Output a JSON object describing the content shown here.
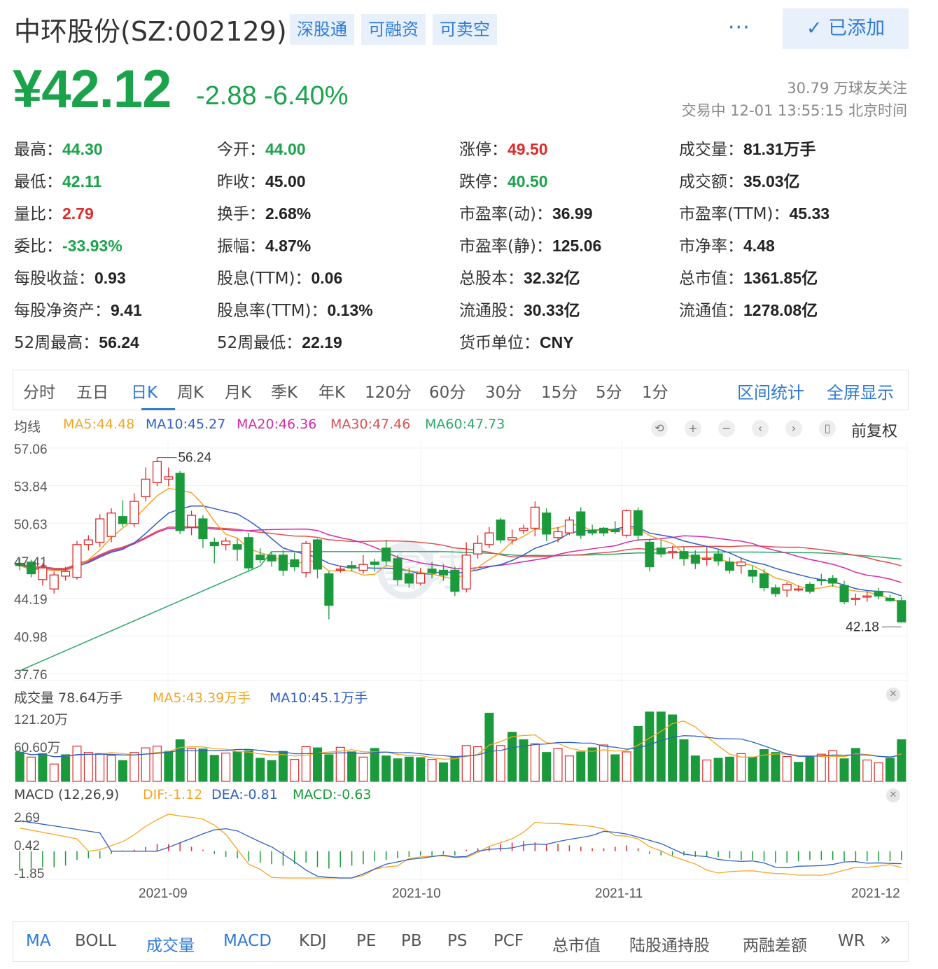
{
  "header": {
    "title": "中环股份(SZ:002129)",
    "tags": [
      "深股通",
      "可融资",
      "可卖空"
    ],
    "more_label": "···",
    "added_label": "已添加"
  },
  "quote": {
    "price": "¥42.12",
    "change": "-2.88 -6.40%",
    "followers": "30.79 万球友关注",
    "status": "交易中 12-01 13:55:15 北京时间"
  },
  "stats": [
    {
      "label": "最高：",
      "value": "44.30",
      "color": "green"
    },
    {
      "label": "今开：",
      "value": "44.00",
      "color": "green"
    },
    {
      "label": "涨停：",
      "value": "49.50",
      "color": "red"
    },
    {
      "label": "成交量：",
      "value": "81.31万手",
      "color": "dark"
    },
    {
      "label": "最低：",
      "value": "42.11",
      "color": "green"
    },
    {
      "label": "昨收：",
      "value": "45.00",
      "color": "dark"
    },
    {
      "label": "跌停：",
      "value": "40.50",
      "color": "green"
    },
    {
      "label": "成交额：",
      "value": "35.03亿",
      "color": "dark"
    },
    {
      "label": "量比：",
      "value": "2.79",
      "color": "red"
    },
    {
      "label": "换手：",
      "value": "2.68%",
      "color": "dark"
    },
    {
      "label": "市盈率(动)：",
      "value": "36.99",
      "color": "dark"
    },
    {
      "label": "市盈率(TTM)：",
      "value": "45.33",
      "color": "dark"
    },
    {
      "label": "委比：",
      "value": "-33.93%",
      "color": "green"
    },
    {
      "label": "振幅：",
      "value": "4.87%",
      "color": "dark"
    },
    {
      "label": "市盈率(静)：",
      "value": "125.06",
      "color": "dark"
    },
    {
      "label": "市净率：",
      "value": "4.48",
      "color": "dark"
    },
    {
      "label": "每股收益：",
      "value": "0.93",
      "color": "dark"
    },
    {
      "label": "股息(TTM)：",
      "value": "0.06",
      "color": "dark"
    },
    {
      "label": "总股本：",
      "value": "32.32亿",
      "color": "dark"
    },
    {
      "label": "总市值：",
      "value": "1361.85亿",
      "color": "dark"
    },
    {
      "label": "每股净资产：",
      "value": "9.41",
      "color": "dark"
    },
    {
      "label": "股息率(TTM)：",
      "value": "0.13%",
      "color": "dark"
    },
    {
      "label": "流通股：",
      "value": "30.33亿",
      "color": "dark"
    },
    {
      "label": "流通值：",
      "value": "1278.08亿",
      "color": "dark"
    },
    {
      "label": "52周最高：",
      "value": "56.24",
      "color": "dark"
    },
    {
      "label": "52周最低：",
      "value": "22.19",
      "color": "dark"
    },
    {
      "label": "货币单位：",
      "value": "CNY",
      "color": "dark"
    }
  ],
  "period_tabs": [
    "分时",
    "五日",
    "日K",
    "周K",
    "月K",
    "季K",
    "年K",
    "120分",
    "60分",
    "30分",
    "15分",
    "5分",
    "1分"
  ],
  "active_period": "日K",
  "right_tabs": [
    "区间统计",
    "全屏显示"
  ],
  "ma_legend": {
    "title": "均线",
    "items": [
      {
        "text": "MA5:44.48",
        "color": "#f5a623"
      },
      {
        "text": "MA10:45.27",
        "color": "#2f5fc4"
      },
      {
        "text": "MA20:46.36",
        "color": "#d62aa8"
      },
      {
        "text": "MA30:47.46",
        "color": "#e05050"
      },
      {
        "text": "MA60:47.73",
        "color": "#2aa86a"
      }
    ],
    "adjust_label": "前复权"
  },
  "chart_data": {
    "type": "candlestick",
    "price_axis": [
      "57.06",
      "53.84",
      "50.63",
      "47.41",
      "44.19",
      "40.98",
      "37.76"
    ],
    "ylim": [
      37.76,
      57.06
    ],
    "high_marker": "56.24",
    "low_marker": "42.18",
    "volume": {
      "title": "成交量 78.64万手",
      "ma5": "MA5:43.39万手",
      "ma10": "MA10:45.1万手",
      "axis": [
        "121.20万",
        "60.60万"
      ],
      "max": 121.2
    },
    "macd": {
      "title": "MACD (12,26,9)",
      "dif": "DIF:-1.12",
      "dea": "DEA:-0.81",
      "macd": "MACD:-0.63",
      "axis": [
        "2.69",
        "0.42",
        "-1.85"
      ]
    },
    "dates": [
      "2021-09",
      "2021-10",
      "2021-11",
      "2021-12"
    ],
    "candles": [
      [
        47.2,
        47.0,
        47.6,
        46.6
      ],
      [
        47.3,
        46.3,
        47.5,
        46.0
      ],
      [
        45.8,
        46.8,
        47.2,
        45.3
      ],
      [
        45.0,
        46.2,
        46.5,
        44.6
      ],
      [
        46.1,
        46.5,
        46.9,
        45.7
      ],
      [
        46.0,
        48.8,
        49.1,
        45.8
      ],
      [
        48.8,
        49.2,
        49.6,
        48.3
      ],
      [
        49.0,
        51.0,
        51.4,
        48.6
      ],
      [
        49.5,
        51.5,
        51.9,
        49.0
      ],
      [
        51.2,
        50.6,
        52.6,
        50.3
      ],
      [
        50.6,
        52.5,
        53.2,
        50.3
      ],
      [
        52.9,
        54.4,
        55.4,
        52.5
      ],
      [
        54.1,
        55.9,
        56.24,
        53.8
      ],
      [
        54.4,
        54.6,
        55.4,
        53.8
      ],
      [
        54.9,
        50.0,
        55.1,
        49.7
      ],
      [
        50.3,
        51.3,
        51.7,
        49.6
      ],
      [
        51.0,
        49.3,
        51.3,
        48.5
      ],
      [
        49.0,
        48.7,
        49.4,
        47.2
      ],
      [
        48.8,
        49.1,
        49.4,
        48.3
      ],
      [
        48.8,
        48.4,
        49.3,
        47.4
      ],
      [
        49.4,
        46.8,
        49.8,
        46.5
      ],
      [
        47.9,
        47.5,
        48.5,
        47.2
      ],
      [
        47.9,
        47.4,
        48.2,
        46.9
      ],
      [
        47.9,
        46.6,
        48.3,
        46.1
      ],
      [
        47.5,
        46.9,
        48.1,
        46.5
      ],
      [
        46.4,
        48.9,
        49.1,
        46.0
      ],
      [
        49.2,
        46.7,
        49.3,
        45.9
      ],
      [
        46.3,
        43.6,
        46.5,
        42.4
      ],
      [
        46.7,
        46.7,
        47.0,
        46.4
      ],
      [
        47.0,
        46.8,
        47.4,
        46.5
      ],
      [
        46.6,
        47.1,
        47.9,
        46.3
      ],
      [
        47.3,
        47.1,
        47.6,
        46.5
      ],
      [
        48.5,
        47.4,
        49.2,
        47.0
      ],
      [
        47.6,
        45.8,
        47.9,
        45.3
      ],
      [
        46.3,
        45.5,
        46.8,
        45.1
      ],
      [
        45.5,
        46.3,
        46.8,
        45.3
      ],
      [
        46.7,
        46.4,
        47.3,
        45.9
      ],
      [
        46.6,
        46.2,
        47.1,
        45.7
      ],
      [
        46.6,
        44.8,
        46.9,
        44.4
      ],
      [
        45.0,
        47.9,
        49.0,
        44.7
      ],
      [
        48.0,
        48.9,
        49.6,
        47.6
      ],
      [
        48.8,
        49.8,
        50.3,
        48.5
      ],
      [
        50.9,
        49.2,
        51.1,
        48.9
      ],
      [
        49.2,
        49.4,
        50.1,
        48.8
      ],
      [
        50.0,
        50.2,
        50.5,
        49.7
      ],
      [
        50.2,
        52.0,
        52.5,
        49.5
      ],
      [
        51.5,
        49.7,
        51.9,
        49.1
      ],
      [
        49.4,
        49.9,
        50.3,
        49.0
      ],
      [
        49.8,
        50.9,
        51.2,
        49.6
      ],
      [
        51.6,
        49.6,
        52.0,
        49.3
      ],
      [
        50.0,
        49.8,
        50.5,
        49.6
      ],
      [
        50.2,
        49.8,
        50.3,
        49.5
      ],
      [
        50.1,
        49.9,
        50.8,
        49.7
      ],
      [
        49.6,
        51.7,
        51.8,
        49.4
      ],
      [
        51.7,
        49.6,
        52.0,
        49.1
      ],
      [
        49.0,
        46.9,
        49.3,
        46.5
      ],
      [
        48.5,
        48.0,
        49.2,
        47.7
      ],
      [
        48.1,
        48.2,
        48.7,
        47.6
      ],
      [
        48.2,
        47.6,
        48.6,
        47.0
      ],
      [
        47.9,
        47.2,
        48.3,
        46.7
      ],
      [
        47.6,
        47.6,
        48.6,
        47.0
      ],
      [
        48.0,
        47.4,
        48.4,
        47.0
      ],
      [
        47.3,
        46.6,
        47.7,
        46.3
      ],
      [
        47.0,
        47.3,
        47.7,
        46.3
      ],
      [
        46.6,
        46.1,
        47.0,
        45.5
      ],
      [
        46.3,
        45.1,
        46.7,
        44.8
      ],
      [
        45.1,
        44.6,
        45.4,
        44.3
      ],
      [
        44.9,
        45.4,
        45.6,
        44.3
      ],
      [
        45.0,
        45.0,
        45.3,
        44.8
      ],
      [
        45.4,
        44.8,
        45.6,
        44.6
      ],
      [
        45.8,
        45.7,
        46.3,
        45.3
      ],
      [
        45.9,
        45.5,
        46.2,
        45.2
      ],
      [
        45.3,
        43.9,
        45.7,
        43.7
      ],
      [
        44.1,
        44.2,
        44.6,
        43.6
      ],
      [
        44.3,
        44.4,
        44.8,
        43.9
      ],
      [
        44.8,
        44.4,
        45.1,
        44.1
      ],
      [
        44.2,
        44.0,
        44.5,
        43.9
      ],
      [
        44.0,
        42.18,
        44.3,
        42.11
      ]
    ],
    "volumes": [
      50.6,
      42,
      48,
      30,
      46,
      61,
      50,
      48,
      45,
      36,
      50,
      58,
      61,
      52,
      72,
      57,
      56,
      45,
      49,
      51,
      53,
      40,
      36,
      52,
      38,
      60,
      58,
      46,
      59,
      51,
      42,
      57,
      44,
      39,
      42,
      41,
      38,
      32,
      42,
      62,
      60,
      118,
      62,
      85,
      72,
      65,
      50,
      57,
      44,
      51,
      58,
      63,
      46,
      51,
      95,
      120,
      120,
      115,
      72,
      44,
      37,
      40,
      42,
      48,
      42,
      55,
      50,
      43,
      33,
      42,
      47,
      53,
      39,
      57,
      37,
      32,
      40,
      72
    ],
    "volume_colors": [
      "g",
      "r",
      "g",
      "r",
      "g",
      "r",
      "r",
      "r",
      "r",
      "g",
      "r",
      "r",
      "r",
      "g",
      "g",
      "r",
      "g",
      "g",
      "r",
      "g",
      "g",
      "g",
      "g",
      "g",
      "r",
      "r",
      "g",
      "g",
      "r",
      "g",
      "r",
      "g",
      "g",
      "g",
      "g",
      "g",
      "r",
      "g",
      "g",
      "r",
      "r",
      "g",
      "r",
      "g",
      "g",
      "r",
      "g",
      "r",
      "r",
      "g",
      "g",
      "r",
      "g",
      "r",
      "g",
      "g",
      "g",
      "g",
      "g",
      "g",
      "r",
      "g",
      "g",
      "r",
      "g",
      "g",
      "g",
      "r",
      "g",
      "g",
      "r",
      "r",
      "g",
      "g",
      "r",
      "r",
      "g",
      "g"
    ],
    "macd_bars": [
      -1.3,
      -1.2,
      -1.1,
      -1.1,
      -1.0,
      -0.6,
      -0.5,
      -0.5,
      -0.2,
      0.05,
      0.1,
      0.3,
      0.5,
      0.5,
      0.6,
      0.3,
      0.1,
      -0.2,
      -0.4,
      -0.5,
      -0.7,
      -0.8,
      -0.9,
      -1.0,
      -0.9,
      -0.8,
      -1.1,
      -1.2,
      -1.1,
      -1.0,
      -0.9,
      -0.7,
      -0.6,
      -0.5,
      -0.4,
      -0.3,
      -0.3,
      -0.2,
      -0.3,
      0.1,
      0.2,
      0.3,
      0.5,
      0.6,
      0.7,
      0.6,
      0.5,
      0.5,
      0.4,
      0.3,
      0.2,
      0.2,
      0.3,
      0.4,
      0.2,
      -0.2,
      -0.3,
      -0.3,
      -0.3,
      -0.4,
      -0.4,
      -0.4,
      -0.5,
      -0.6,
      -0.6,
      -0.7,
      -0.8,
      -0.8,
      -0.7,
      -0.6,
      -0.6,
      -0.6,
      -0.7,
      -0.7,
      -0.7,
      -0.7,
      -0.7,
      -0.63
    ]
  },
  "indicator_tabs": [
    "MA",
    "BOLL",
    "成交量",
    "MACD",
    "KDJ",
    "PE",
    "PB",
    "PS",
    "PCF",
    "总市值",
    "陆股通持股",
    "两融差额",
    "WR"
  ],
  "indicator_more": "»",
  "watermark": "雪球",
  "colors": {
    "up": "#e02a2a",
    "down": "#1a9a3a",
    "accent": "#2f7ad6"
  }
}
